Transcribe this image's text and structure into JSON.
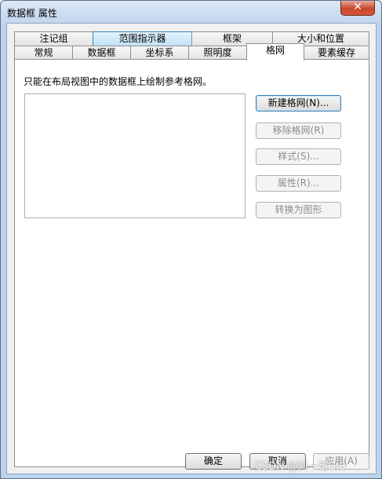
{
  "window": {
    "title": "数据框 属性",
    "close_glyph": "✕"
  },
  "tabs": {
    "row_top": [
      {
        "label": "注记组"
      },
      {
        "label": "范围指示器"
      },
      {
        "label": "框架"
      },
      {
        "label": "大小和位置"
      }
    ],
    "row_bottom": [
      {
        "label": "常规"
      },
      {
        "label": "数据框"
      },
      {
        "label": "坐标系"
      },
      {
        "label": "照明度"
      },
      {
        "label": "格网"
      },
      {
        "label": "要素缓存"
      }
    ],
    "active": "格网"
  },
  "grid_page": {
    "description": "只能在布局视图中的数据框上绘制参考格网。",
    "buttons": {
      "new_grid": "新建格网(N)...",
      "remove_grid": "移除格网(R)",
      "style": "样式(S)...",
      "properties": "属性(R)...",
      "convert_to_graphics": "转换为图形"
    }
  },
  "footer": {
    "ok": "确定",
    "cancel": "取消",
    "apply": "应用(A)"
  },
  "watermark": "CSDN @刘一哥GIS"
}
